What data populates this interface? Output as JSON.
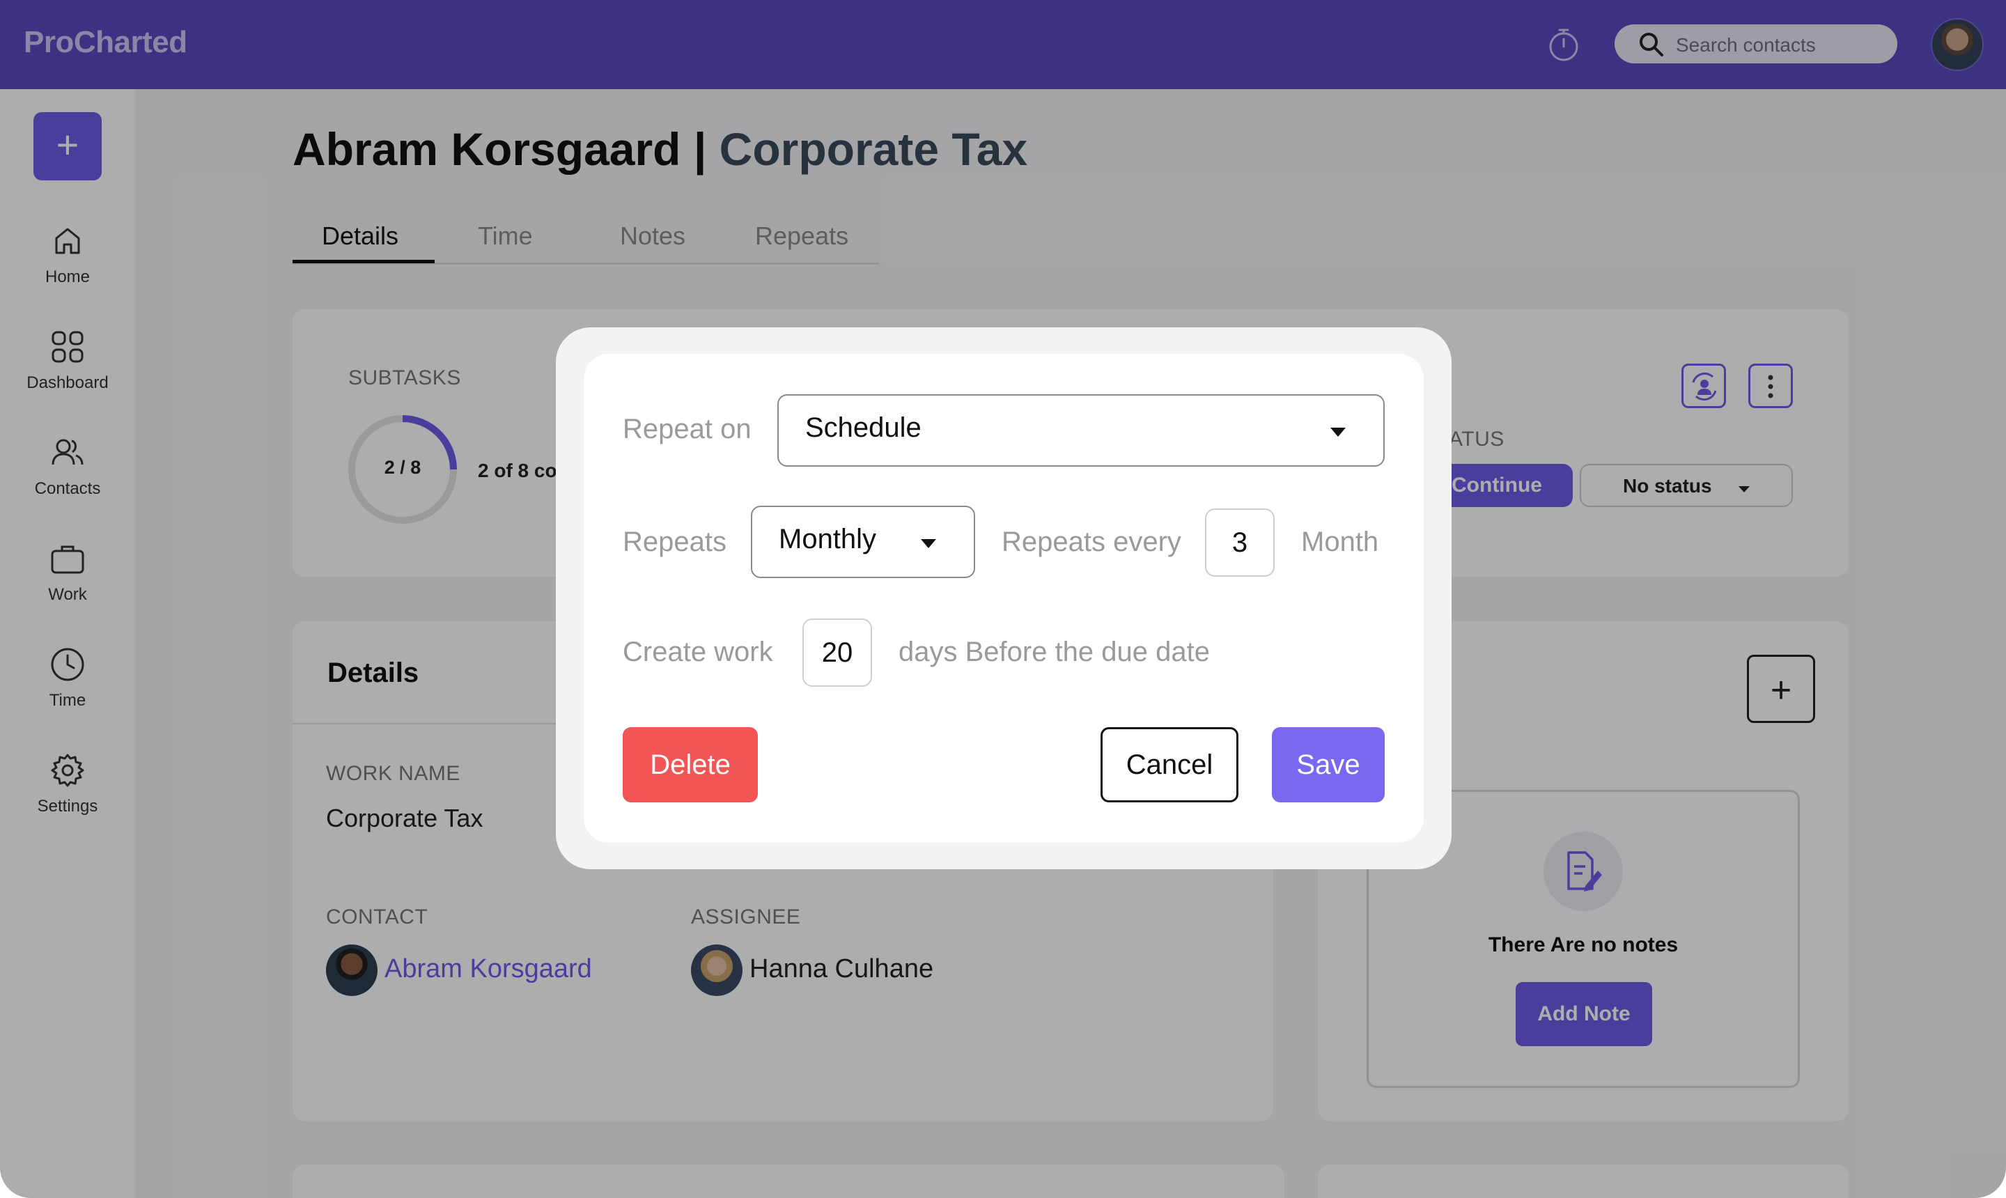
{
  "app": {
    "name": "ProCharted"
  },
  "topbar": {
    "search_placeholder": "Search contacts"
  },
  "sidebar": {
    "add_label": "+",
    "items": [
      {
        "label": "Home",
        "icon": "home-icon"
      },
      {
        "label": "Dashboard",
        "icon": "dashboard-icon"
      },
      {
        "label": "Contacts",
        "icon": "contacts-icon"
      },
      {
        "label": "Work",
        "icon": "briefcase-icon"
      },
      {
        "label": "Time",
        "icon": "clock-icon"
      },
      {
        "label": "Settings",
        "icon": "gear-icon"
      }
    ]
  },
  "header": {
    "name": "Abram Korsgaard",
    "separator": "|",
    "work": "Corporate Tax"
  },
  "tabs": [
    {
      "label": "Details",
      "active": true
    },
    {
      "label": "Time",
      "active": false
    },
    {
      "label": "Notes",
      "active": false
    },
    {
      "label": "Repeats",
      "active": false
    }
  ],
  "subtasks": {
    "label": "SUBTASKS",
    "ring_text": "2 / 8",
    "summary": "2 of 8 co",
    "progress": 0.25
  },
  "status": {
    "label": "ATUS",
    "continue_label": "Continue",
    "status_value": "No status"
  },
  "details": {
    "title": "Details",
    "work_name_label": "WORK NAME",
    "work_name": "Corporate Tax",
    "contact_label": "CONTACT",
    "contact_name": "Abram Korsgaard",
    "assignee_label": "ASSIGNEE",
    "assignee_name": "Hanna Culhane"
  },
  "notes": {
    "add_icon": "+",
    "empty_text": "There Are no notes",
    "add_note_label": "Add Note"
  },
  "modal": {
    "repeat_on_label": "Repeat on",
    "repeat_on_value": "Schedule",
    "repeats_label": "Repeats",
    "repeats_value": "Monthly",
    "repeats_every_label": "Repeats every",
    "repeats_every_value": "3",
    "unit": "Month",
    "create_work_label": "Create work",
    "create_work_value": "20",
    "days_text": "days Before the due date",
    "delete_label": "Delete",
    "cancel_label": "Cancel",
    "save_label": "Save"
  },
  "colors": {
    "brand": "#5b4bbf",
    "accent": "#6e5ce6",
    "danger": "#f25555",
    "save": "#7b68f0"
  }
}
